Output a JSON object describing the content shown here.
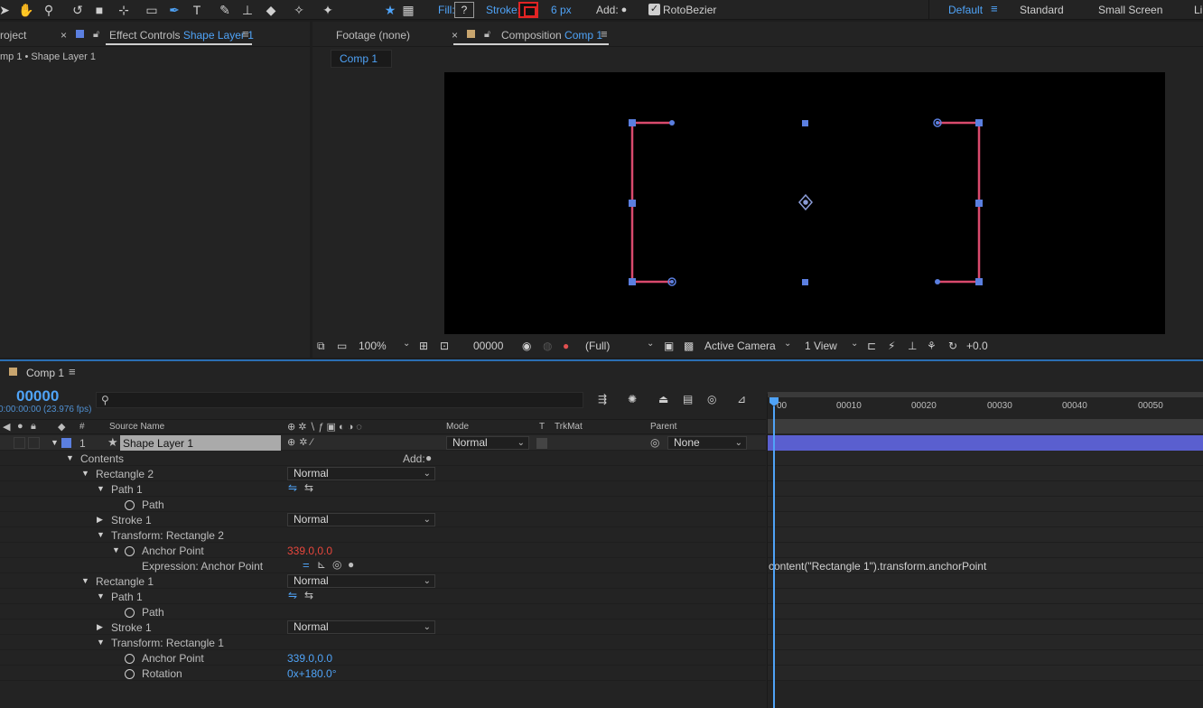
{
  "toolbar": {
    "fill_label": "Fill:",
    "fill_value": "?",
    "stroke_label": "Stroke:",
    "stroke_width": "6 px",
    "add_label": "Add:",
    "rotobezier_label": "RotoBezier",
    "workspaces": [
      "Default",
      "Standard",
      "Small Screen",
      "Li"
    ]
  },
  "left_panel": {
    "project_tab": "roject",
    "effect_controls_prefix": "Effect Controls",
    "effect_controls_layer": "Shape Layer 1",
    "breadcrumb": "mp 1 • Shape Layer 1"
  },
  "comp_panel": {
    "footage_tab": "Footage (none)",
    "composition_prefix": "Composition",
    "composition_name": "Comp 1",
    "comp_chip": "Comp 1"
  },
  "viewer_bar": {
    "zoom": "100%",
    "timecode": "00000",
    "resolution": "(Full)",
    "camera": "Active Camera",
    "views": "1 View",
    "exposure": "+0.0"
  },
  "timeline": {
    "tab_title": "Comp 1",
    "current_time": "00000",
    "fps": "0:00:00:00 (23.976 fps)",
    "search_placeholder": "",
    "headers": {
      "num": "#",
      "source_name": "Source Name",
      "mode": "Mode",
      "t": "T",
      "trkmat": "TrkMat",
      "parent": "Parent"
    },
    "ruler": [
      "00",
      "00010",
      "00020",
      "00030",
      "00040",
      "00050"
    ],
    "layer": {
      "index": "1",
      "name": "Shape Layer 1",
      "mode": "Normal",
      "parent": "None"
    },
    "properties": {
      "contents": "Contents",
      "add": "Add:",
      "rect2": "Rectangle 2",
      "rect2_mode": "Normal",
      "path1": "Path 1",
      "path": "Path",
      "stroke1": "Stroke 1",
      "stroke1_mode": "Normal",
      "transform2": "Transform: Rectangle 2",
      "anchor_point": "Anchor Point",
      "anchor_value_red": "339.0,0.0",
      "expression_label": "Expression: Anchor Point",
      "expression_text": "content(\"Rectangle 1\").transform.anchorPoint",
      "rect1": "Rectangle 1",
      "rect1_mode": "Normal",
      "path1b": "Path 1",
      "pathb": "Path",
      "stroke1b": "Stroke 1",
      "stroke1b_mode": "Normal",
      "transform1": "Transform: Rectangle 1",
      "anchor_point_b": "Anchor Point",
      "anchor_value_blue": "339.0,0.0",
      "rotation": "Rotation",
      "rotation_value": "0x+180.0°"
    }
  },
  "colors": {
    "accent": "#4fa3f7",
    "stroke_red": "#e02424",
    "shape_stroke": "#d94a6d",
    "handle": "#5b7fe0",
    "layer_bar": "#5a5fcf"
  }
}
